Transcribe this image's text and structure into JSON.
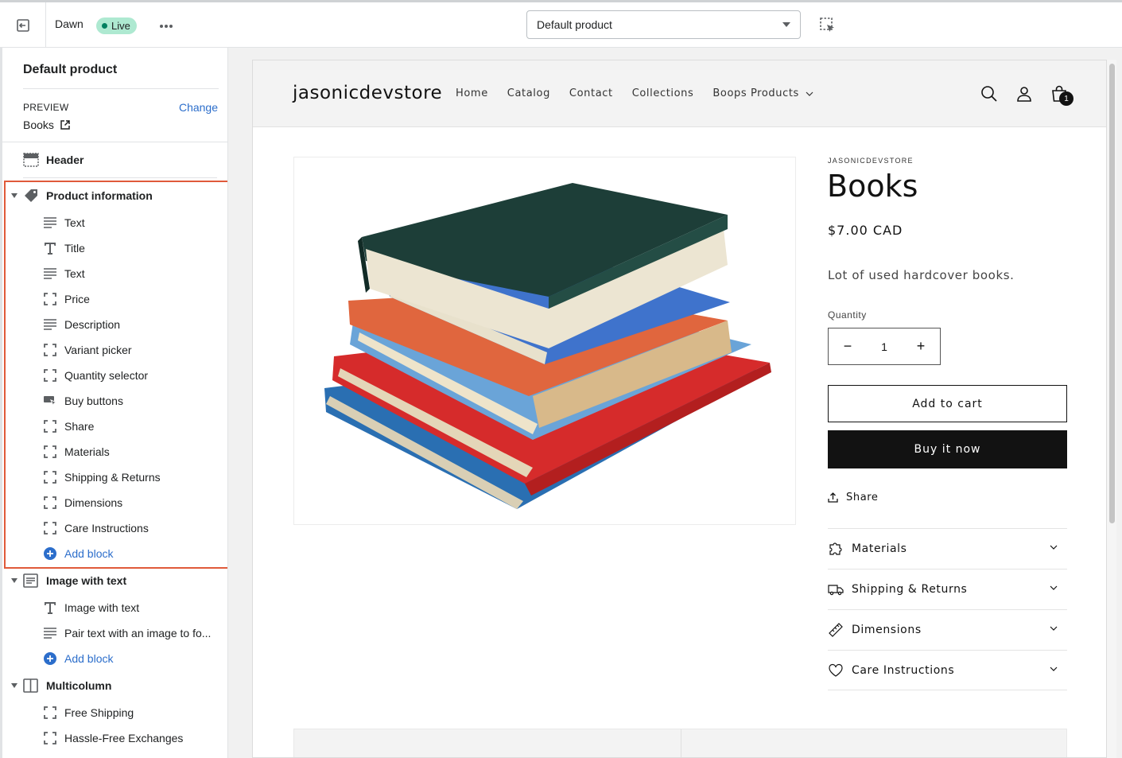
{
  "topbar": {
    "theme_name": "Dawn",
    "live_badge": "Live",
    "template_select": "Default product"
  },
  "sidebar": {
    "title": "Default product",
    "preview_label": "PREVIEW",
    "change_link": "Change",
    "preview_value": "Books",
    "header_section": "Header",
    "product_info": {
      "label": "Product information",
      "blocks": [
        {
          "label": "Text",
          "icon": "text-lines-icon"
        },
        {
          "label": "Title",
          "icon": "title-t-icon"
        },
        {
          "label": "Text",
          "icon": "text-lines-icon"
        },
        {
          "label": "Price",
          "icon": "block-corners-icon"
        },
        {
          "label": "Description",
          "icon": "text-lines-icon"
        },
        {
          "label": "Variant picker",
          "icon": "block-corners-icon"
        },
        {
          "label": "Quantity selector",
          "icon": "block-corners-icon"
        },
        {
          "label": "Buy buttons",
          "icon": "buy-button-icon"
        },
        {
          "label": "Share",
          "icon": "block-corners-icon"
        },
        {
          "label": "Materials",
          "icon": "block-corners-icon"
        },
        {
          "label": "Shipping & Returns",
          "icon": "block-corners-icon"
        },
        {
          "label": "Dimensions",
          "icon": "block-corners-icon"
        },
        {
          "label": "Care Instructions",
          "icon": "block-corners-icon"
        }
      ],
      "add_block": "Add block"
    },
    "image_with_text": {
      "label": "Image with text",
      "blocks": [
        {
          "label": "Image with text",
          "icon": "title-t-icon"
        },
        {
          "label": "Pair text with an image to fo...",
          "icon": "text-lines-icon"
        }
      ],
      "add_block": "Add block"
    },
    "multicolumn": {
      "label": "Multicolumn",
      "blocks": [
        {
          "label": "Free Shipping",
          "icon": "block-corners-icon"
        },
        {
          "label": "Hassle-Free Exchanges",
          "icon": "block-corners-icon"
        }
      ]
    }
  },
  "store": {
    "name": "jasonicdevstore",
    "nav": [
      "Home",
      "Catalog",
      "Contact",
      "Collections",
      "Boops Products"
    ],
    "cart_count": "1"
  },
  "product": {
    "vendor": "JASONICDEVSTORE",
    "title": "Books",
    "price": "$7.00 CAD",
    "description": "Lot of used hardcover books.",
    "quantity_label": "Quantity",
    "quantity_value": "1",
    "add_to_cart": "Add to cart",
    "buy_now": "Buy it now",
    "share": "Share",
    "accordions": [
      {
        "label": "Materials",
        "icon": "puzzle-icon"
      },
      {
        "label": "Shipping & Returns",
        "icon": "truck-icon"
      },
      {
        "label": "Dimensions",
        "icon": "ruler-icon"
      },
      {
        "label": "Care Instructions",
        "icon": "heart-icon"
      }
    ]
  },
  "colors": {
    "accent": "#2c6ecb",
    "highlight": "#e05a3a",
    "live_badge": "#aee9d1",
    "button_dark": "#121212"
  }
}
